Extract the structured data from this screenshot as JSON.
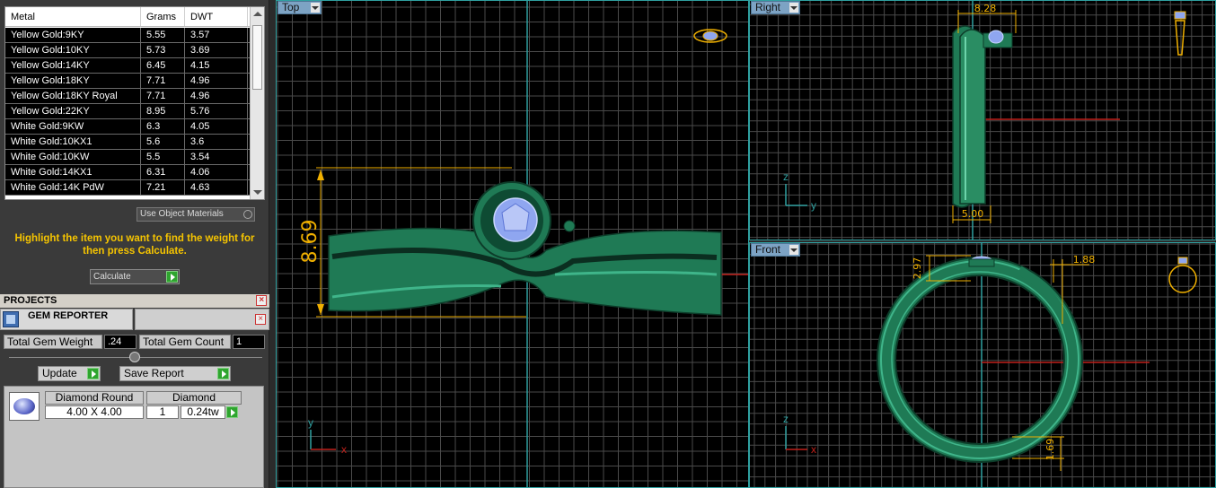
{
  "metal_table": {
    "headers": [
      "Metal",
      "Grams",
      "DWT"
    ],
    "rows": [
      [
        "Yellow Gold:9KY",
        "5.55",
        "3.57"
      ],
      [
        "Yellow Gold:10KY",
        "5.73",
        "3.69"
      ],
      [
        "Yellow Gold:14KY",
        "6.45",
        "4.15"
      ],
      [
        "Yellow Gold:18KY",
        "7.71",
        "4.96"
      ],
      [
        "Yellow Gold:18KY Royal",
        "7.71",
        "4.96"
      ],
      [
        "Yellow Gold:22KY",
        "8.95",
        "5.76"
      ],
      [
        "White Gold:9KW",
        "6.3",
        "4.05"
      ],
      [
        "White Gold:10KX1",
        "5.6",
        "3.6"
      ],
      [
        "White Gold:10KW",
        "5.5",
        "3.54"
      ],
      [
        "White Gold:14KX1",
        "6.31",
        "4.06"
      ],
      [
        "White Gold:14K PdW",
        "7.21",
        "4.63"
      ]
    ]
  },
  "use_object_materials": "Use Object Materials",
  "hint": "Highlight the item you want to find the weight for then press Calculate.",
  "calculate": "Calculate",
  "projects_title": "PROJECTS",
  "gem_reporter_title": "GEM REPORTER",
  "total_gem_weight_label": "Total Gem Weight",
  "total_gem_weight_value": ".24",
  "total_gem_count_label": "Total Gem Count",
  "total_gem_count_value": "1",
  "update_label": "Update",
  "save_report_label": "Save Report",
  "gem": {
    "shape": "Diamond Round",
    "type": "Diamond",
    "size": "4.00 X 4.00",
    "count": "1",
    "weight": "0.24tw"
  },
  "viewports": {
    "top": "Top",
    "right": "Right",
    "front": "Front"
  },
  "dims": {
    "top_height": "8.69",
    "right_width": "8.28",
    "right_bottom": "5.00",
    "front_a": "2.97",
    "front_b": "1.88",
    "front_c": "1.69"
  },
  "axes": {
    "y": "y",
    "x": "x",
    "z": "z"
  },
  "colors": {
    "model": "#1f7a55",
    "model_light": "#3fb58a",
    "gem": "#8fa6f0",
    "dim": "#f0b000",
    "grid": "#4a4a4a",
    "accent": "#2fa0a0"
  }
}
